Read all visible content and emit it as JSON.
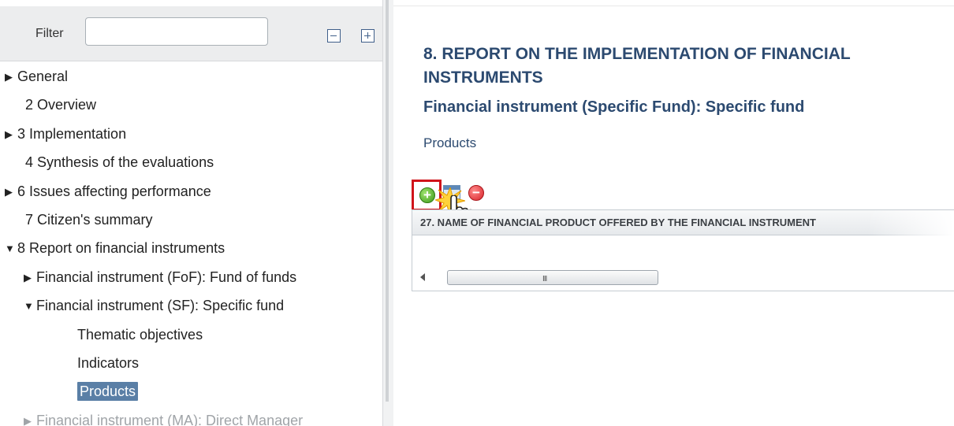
{
  "filter": {
    "label": "Filter",
    "value": "",
    "collapse_all_icon": "minus-box-icon",
    "expand_all_icon": "plus-box-icon"
  },
  "tree": {
    "items": [
      {
        "label": "General",
        "expander": "collapsed"
      },
      {
        "label": "2 Overview",
        "expander": "none"
      },
      {
        "label": "3 Implementation",
        "expander": "collapsed"
      },
      {
        "label": "4 Synthesis of the evaluations",
        "expander": "none"
      },
      {
        "label": "6 Issues affecting performance",
        "expander": "collapsed"
      },
      {
        "label": "7 Citizen's summary",
        "expander": "none"
      },
      {
        "label": "8 Report on financial instruments",
        "expander": "expanded"
      },
      {
        "label": "Financial instrument (FoF): Fund of funds",
        "expander": "collapsed"
      },
      {
        "label": "Financial instrument (SF): Specific fund",
        "expander": "expanded"
      },
      {
        "label": "Thematic objectives",
        "expander": "none"
      },
      {
        "label": "Indicators",
        "expander": "none"
      },
      {
        "label": "Products",
        "expander": "none",
        "selected": true
      },
      {
        "label": "Financial instrument (MA): Direct Manager",
        "expander": "collapsed",
        "disabled": true
      }
    ]
  },
  "content": {
    "section_title": "8. REPORT ON THE IMPLEMENTATION OF FINANCIAL INSTRUMENTS",
    "subtitle": "Financial instrument (Specific Fund): Specific fund",
    "products_label": "Products",
    "toolbar": {
      "add_icon": "add-circle-icon",
      "edit_icon": "edit-window-icon",
      "delete_icon": "remove-circle-icon",
      "add_symbol": "+",
      "delete_symbol": "−"
    },
    "grid": {
      "header": "27. NAME OF FINANCIAL PRODUCT OFFERED BY THE FINANCIAL INSTRUMENT",
      "rows": [],
      "scroll_grip": "III"
    }
  },
  "colors": {
    "title": "#2c4a70",
    "selected_bg": "#5a7fa6",
    "highlight_border": "#d0131a",
    "filter_bg": "#ecedee"
  }
}
